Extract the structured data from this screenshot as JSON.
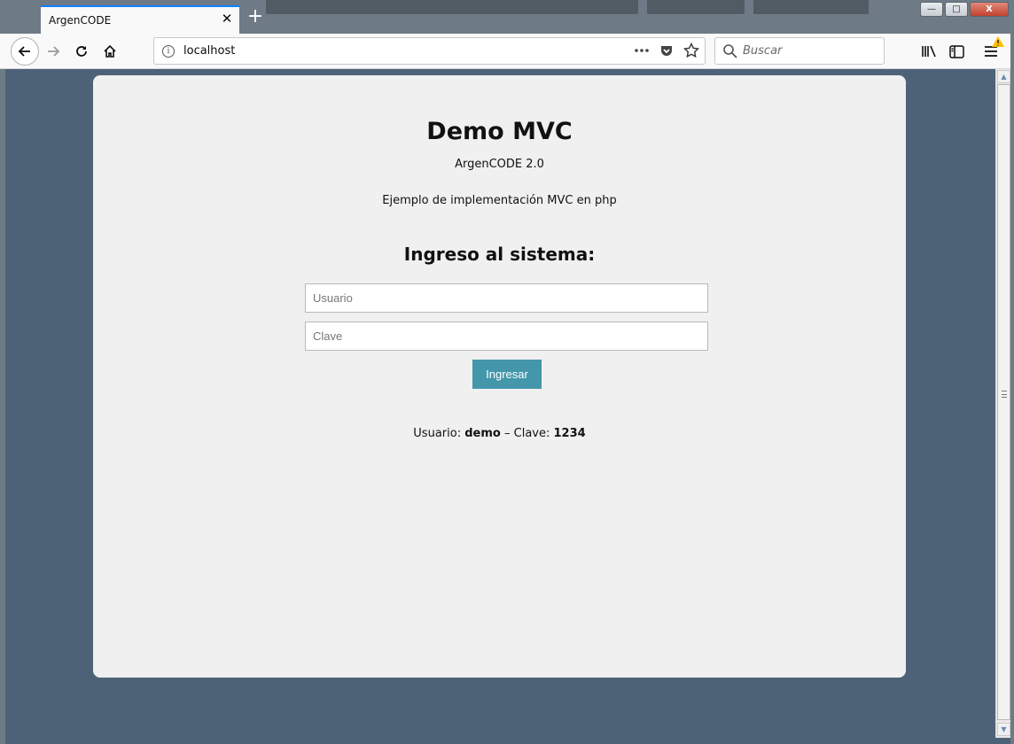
{
  "window": {
    "tab_title": "ArgenCODE",
    "new_tab_symbol": "+",
    "controls": {
      "minimize": "—",
      "maximize": "□",
      "close": "X"
    }
  },
  "toolbar": {
    "url": "localhost",
    "search_placeholder": "Buscar",
    "icons": [
      "back-arrow-icon",
      "forward-arrow-icon",
      "reload-icon",
      "home-icon",
      "info-icon",
      "more-dots-icon",
      "pocket-icon",
      "bookmark-star-icon",
      "search-icon",
      "library-icon",
      "sidebar-icon",
      "menu-icon",
      "warning-icon"
    ]
  },
  "page": {
    "title": "Demo MVC",
    "subtitle": "ArgenCODE 2.0",
    "description": "Ejemplo de implementación MVC en php",
    "login_heading": "Ingreso al sistema:",
    "username_placeholder": "Usuario",
    "password_placeholder": "Clave",
    "submit_label": "Ingresar",
    "hint": {
      "user_label": "Usuario:",
      "user_value": "demo",
      "separator": "–",
      "pass_label": "Clave:",
      "pass_value": "1234"
    }
  },
  "colors": {
    "background": "#4d6277",
    "card": "#f0f0f0",
    "button": "#4497ab",
    "tab_accent": "#0a84ff"
  }
}
